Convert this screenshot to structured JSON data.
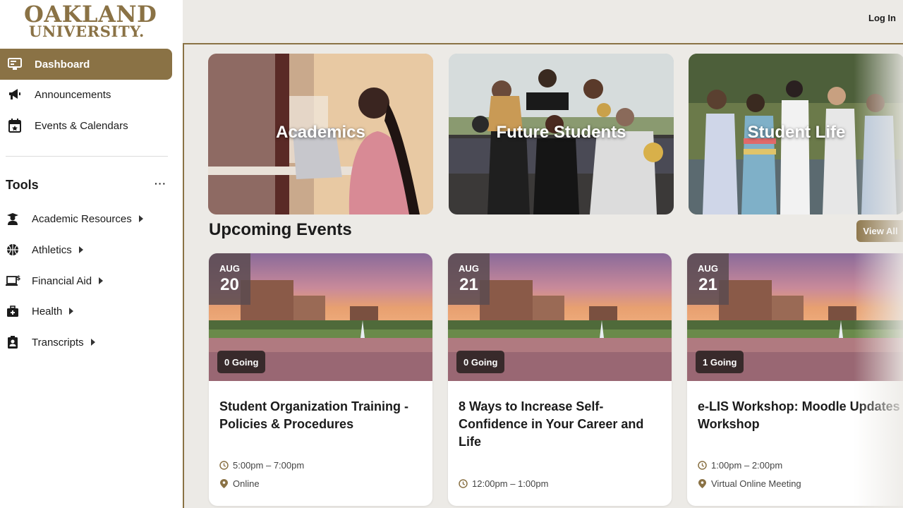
{
  "logo": {
    "line1": "OAKLAND",
    "line2": "UNIVERSITY."
  },
  "header": {
    "login_label": "Log In"
  },
  "nav": [
    {
      "label": "Dashboard",
      "icon": "monitor-icon",
      "active": true
    },
    {
      "label": "Announcements",
      "icon": "megaphone-icon"
    },
    {
      "label": "Events & Calendars",
      "icon": "calendar-icon"
    }
  ],
  "tools": {
    "title": "Tools",
    "more": "···",
    "items": [
      {
        "label": "Academic Resources",
        "icon": "graduate-icon"
      },
      {
        "label": "Athletics",
        "icon": "basketball-icon"
      },
      {
        "label": "Financial Aid",
        "icon": "laptop-dollar-icon"
      },
      {
        "label": "Health",
        "icon": "medical-kit-icon"
      },
      {
        "label": "Transcripts",
        "icon": "id-badge-icon"
      }
    ]
  },
  "categories": [
    {
      "label": "Academics"
    },
    {
      "label": "Future Students"
    },
    {
      "label": "Student Life"
    }
  ],
  "events_section": {
    "title": "Upcoming Events",
    "view_all": "View All"
  },
  "events": [
    {
      "month": "AUG",
      "day": "20",
      "going": "0 Going",
      "title": "Student Organization Training - Policies & Procedures",
      "time": "5:00pm – 7:00pm",
      "location": "Online"
    },
    {
      "month": "AUG",
      "day": "21",
      "going": "0 Going",
      "title": "8 Ways to Increase Self-Confidence in Your Career and Life",
      "time": "12:00pm – 1:00pm",
      "location": ""
    },
    {
      "month": "AUG",
      "day": "21",
      "going": "1 Going",
      "title": "e-LIS Workshop: Moodle Updates Workshop",
      "time": "1:00pm – 2:00pm",
      "location": "Virtual Online Meeting"
    }
  ],
  "colors": {
    "accent": "#8a7245",
    "background": "#eceae6"
  }
}
